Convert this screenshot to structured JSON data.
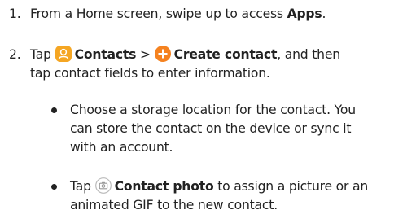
{
  "steps": [
    {
      "number": "1.",
      "text_before": "From a Home screen, swipe up to access ",
      "bold": "Apps",
      "text_after": "."
    },
    {
      "number": "2.",
      "tap": "Tap",
      "contacts_label": "Contacts",
      "separator": ">",
      "create_label": "Create contact",
      "line1_after": ", and then",
      "line2": "tap contact fields to enter information."
    }
  ],
  "bullets": [
    {
      "lines": [
        "Choose a storage location for the contact. You",
        "can store the contact on the device or sync it",
        "with an account."
      ]
    },
    {
      "tap": "Tap",
      "bold": "Contact photo",
      "line1_after": " to assign a picture or an",
      "line2": "animated GIF to the new contact."
    }
  ],
  "icons": {
    "contacts": "contacts-app-icon",
    "create": "plus-circle-icon",
    "photo": "camera-icon"
  },
  "colors": {
    "text": "#222222",
    "contacts_icon": "#F5A623",
    "create_icon": "#F58220",
    "camera_icon_outline": "#BBBBBB"
  }
}
